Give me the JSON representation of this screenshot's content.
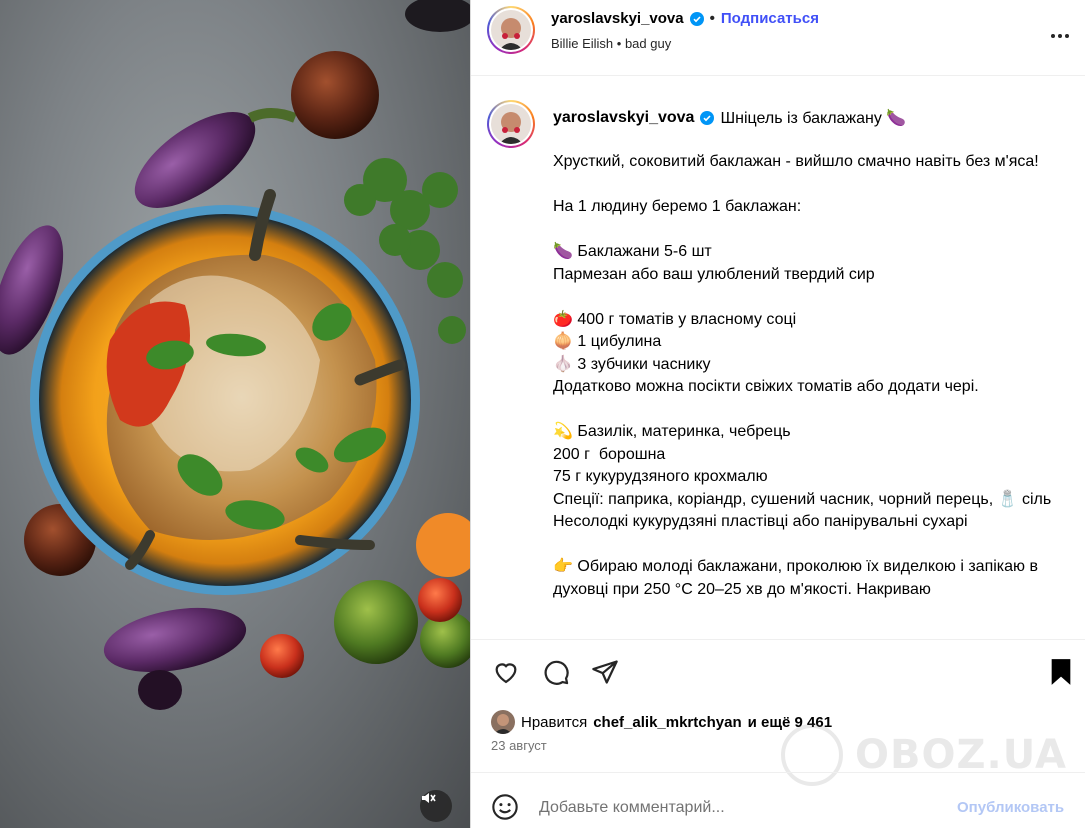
{
  "header": {
    "username": "yaroslavskyi_vova",
    "separator": "•",
    "follow_label": "Подписаться",
    "artist": "Billie Eilish",
    "music_sep": "•",
    "track": "bad guy"
  },
  "caption": {
    "username": "yaroslavskyi_vova",
    "title": "Шніцель із баклажану 🍆",
    "text": "Хрусткий, соковитий баклажан - вийшло смачно навіть без м'яса!\n\nНа 1 людину беремо 1 баклажан:\n\n🍆 Баклажани 5-6 шт\nПармезан або ваш улюблений твердий сир\n\n🍅 400 г томатів у власному соці\n🧅 1 цибулина\n🧄 3 зубчики часнику\nДодатково можна посікти свіжих томатів або додати чері.\n\n💫 Базилік, материнка, чебрець\n200 г  борошна\n75 г кукурудзяного крохмалю\nСпеції: паприка, коріандр, сушений часник, чорний перець, 🧂 сіль\nНесолодкі кукурудзяні пластівці або панірувальні сухарі\n\n👉 Обираю молоді баклажани, проколюю їх виделкою і запікаю в духовці при 250 °С 20–25 хв до м'якості. Накриваю"
  },
  "likes": {
    "prefix": "Нравится",
    "user": "chef_alik_mkrtchyan",
    "suffix": "и ещё 9 461"
  },
  "date": "23 август",
  "comment": {
    "placeholder": "Добавьте комментарий...",
    "post_label": "Опубликовать"
  },
  "watermark": {
    "text": "OBOZ.UA"
  },
  "icons": {
    "verified": "verified-badge-icon",
    "more": "more-options-icon",
    "like": "heart-icon",
    "comment": "comment-icon",
    "share": "share-icon",
    "save": "bookmark-icon",
    "emoji": "emoji-icon",
    "mute": "muted-speaker-icon"
  },
  "colors": {
    "accent": "#4150f7",
    "verified": "#0095f6",
    "post_disabled": "#b3c7f5",
    "plate_orange": "#f4a21c"
  }
}
